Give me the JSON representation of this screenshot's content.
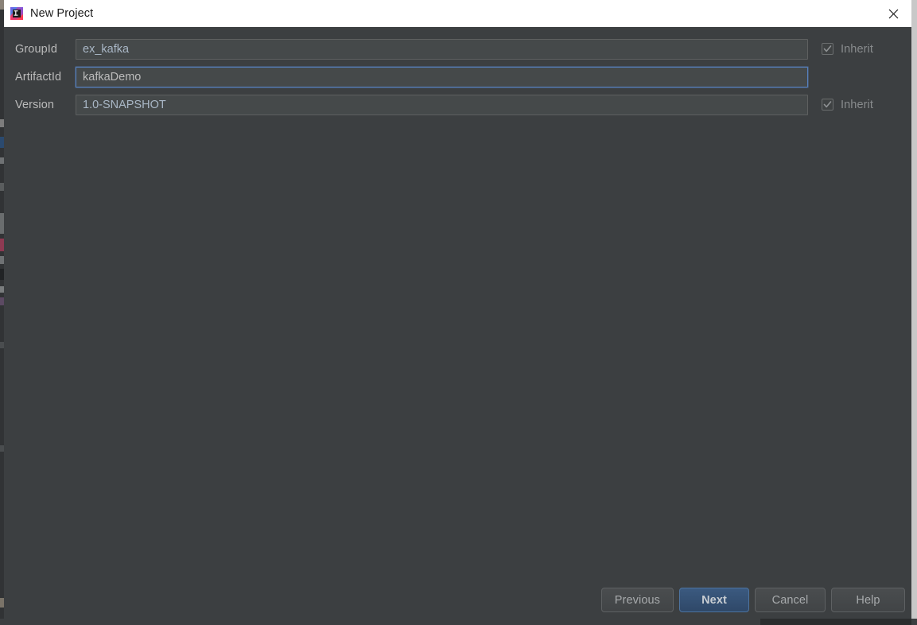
{
  "window": {
    "title": "New Project",
    "app_icon": "intellij-idea-icon",
    "close_icon": "close-icon"
  },
  "form": {
    "rows": [
      {
        "label": "GroupId",
        "value": "ex_kafka",
        "placeholder": "",
        "focused": false,
        "has_inherit": true,
        "inherit_label": "Inherit",
        "inherit_checked": true
      },
      {
        "label": "ArtifactId",
        "value": "kafkaDemo",
        "placeholder": "",
        "focused": true,
        "has_inherit": false,
        "inherit_label": "",
        "inherit_checked": false
      },
      {
        "label": "Version",
        "value": "1.0-SNAPSHOT",
        "placeholder": "",
        "focused": false,
        "has_inherit": true,
        "inherit_label": "Inherit",
        "inherit_checked": true
      }
    ]
  },
  "footer": {
    "previous_label": "Previous",
    "next_label": "Next",
    "cancel_label": "Cancel",
    "help_label": "Help"
  },
  "colors": {
    "dialog_background": "#3c3f41",
    "titlebar_background": "#ffffff",
    "input_background": "#45494a",
    "focus_border": "#5781bf",
    "primary_button": "#365880",
    "label_text": "#bbbbbb",
    "input_text": "#a9b7c6"
  }
}
